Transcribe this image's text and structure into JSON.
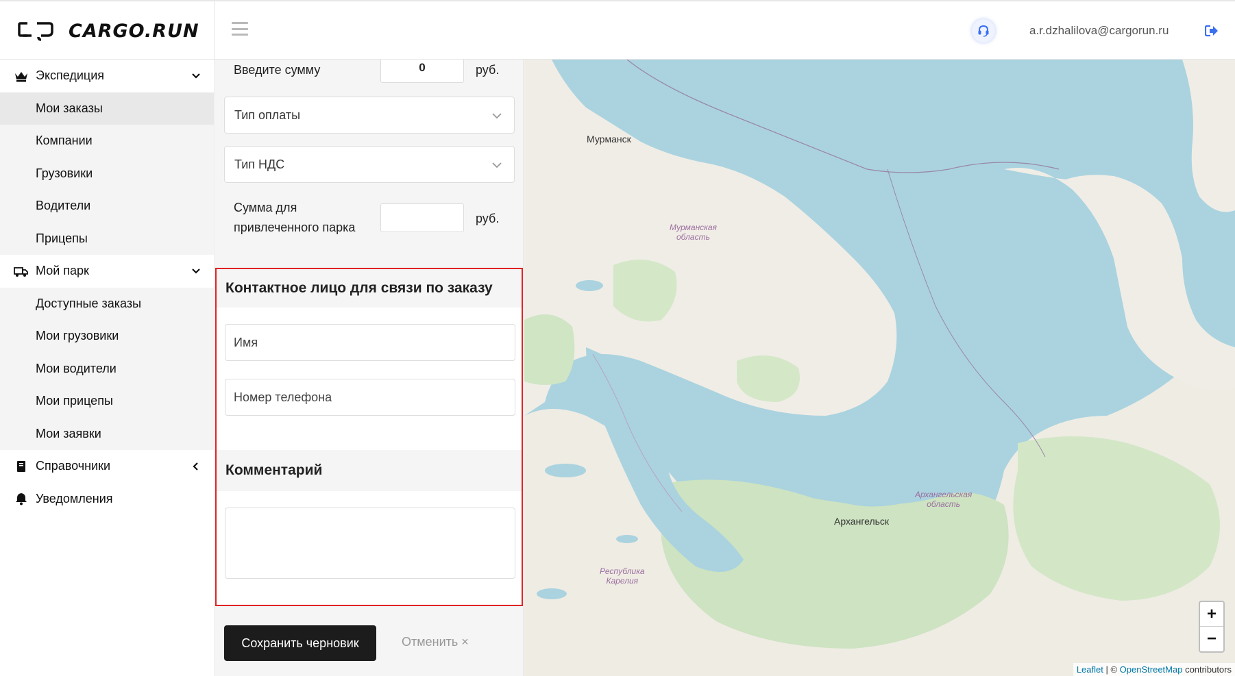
{
  "header": {
    "logo_text": "CARGO.RUN",
    "user_email": "a.r.dzhalilova@cargorun.ru",
    "icons": [
      "menu-icon",
      "headset-icon",
      "logout-icon"
    ],
    "accent_color": "#3a6ff0"
  },
  "sidebar": {
    "groups": [
      {
        "label": "Экспедиция",
        "icon": "crown-icon",
        "expanded": true,
        "items": [
          "Мои заказы",
          "Компании",
          "Грузовики",
          "Водители",
          "Прицепы"
        ]
      },
      {
        "label": "Мой парк",
        "icon": "truck-icon",
        "expanded": true,
        "items": [
          "Доступные заказы",
          "Мои грузовики",
          "Мои водители",
          "Мои прицепы",
          "Мои заявки"
        ]
      },
      {
        "label": "Справочники",
        "icon": "book-icon",
        "expanded": false
      },
      {
        "label": "Уведомления",
        "icon": "bell-icon"
      }
    ],
    "active_item": "Мои заказы"
  },
  "form": {
    "sum_label": "Введите сумму",
    "sum_value": "0",
    "currency": "руб.",
    "payment_type_placeholder": "Тип оплаты",
    "vat_type_placeholder": "Тип НДС",
    "fleet_sum_label_line1": "Сумма для",
    "fleet_sum_label_line2": "привлеченного парка",
    "fleet_sum_value": "",
    "contact_section_title": "Контактное лицо для связи по заказу",
    "name_placeholder": "Имя",
    "phone_placeholder": "Номер телефона",
    "comment_section_title": "Комментарий",
    "comment_value": "",
    "save_button": "Сохранить черновик",
    "cancel_button": "Отменить ×",
    "highlight_color": "#e02323"
  },
  "map": {
    "cities": [
      "Мурманск",
      "Архангельск"
    ],
    "regions": [
      {
        "line1": "Мурманская",
        "line2": "область"
      },
      {
        "line1": "Архангельская",
        "line2": "область"
      },
      {
        "line1": "Республика",
        "line2": "Карелия"
      }
    ],
    "zoom_in": "+",
    "zoom_out": "−",
    "attribution": {
      "leaflet": "Leaflet",
      "separator": " | © ",
      "osm": "OpenStreetMap",
      "suffix": " contributors"
    }
  }
}
